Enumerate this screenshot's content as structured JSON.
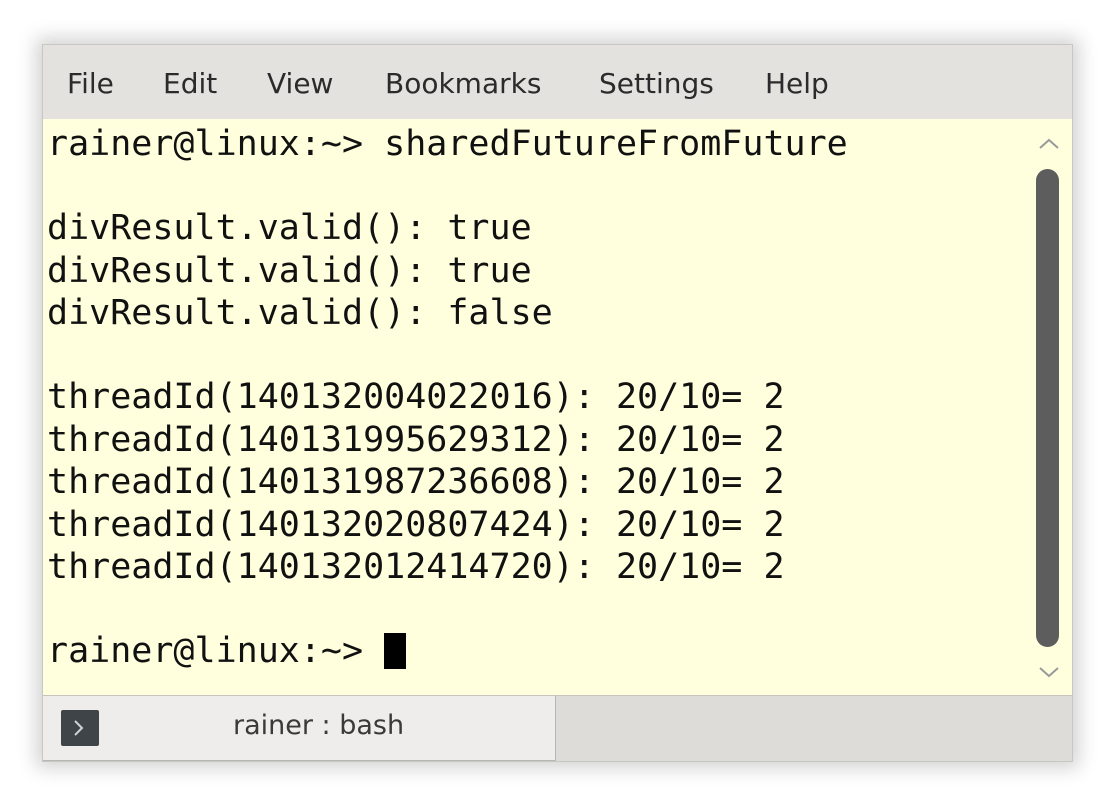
{
  "menu": {
    "items": [
      "File",
      "Edit",
      "View",
      "Bookmarks",
      "Settings",
      "Help"
    ]
  },
  "terminal": {
    "background": "#ffffdd",
    "lines": [
      "rainer@linux:~> sharedFutureFromFuture",
      "",
      "divResult.valid(): true",
      "divResult.valid(): true",
      "divResult.valid(): false",
      "",
      "threadId(140132004022016): 20/10= 2",
      "threadId(140131995629312): 20/10= 2",
      "threadId(140131987236608): 20/10= 2",
      "threadId(140132020807424): 20/10= 2",
      "threadId(140132012414720): 20/10= 2",
      "",
      "rainer@linux:~> "
    ]
  },
  "scrollbar": {
    "up_icon": "chevron-up-icon",
    "down_icon": "chevron-down-icon"
  },
  "tabs": [
    {
      "label": "rainer : bash",
      "icon": "terminal-icon",
      "active": true
    }
  ]
}
